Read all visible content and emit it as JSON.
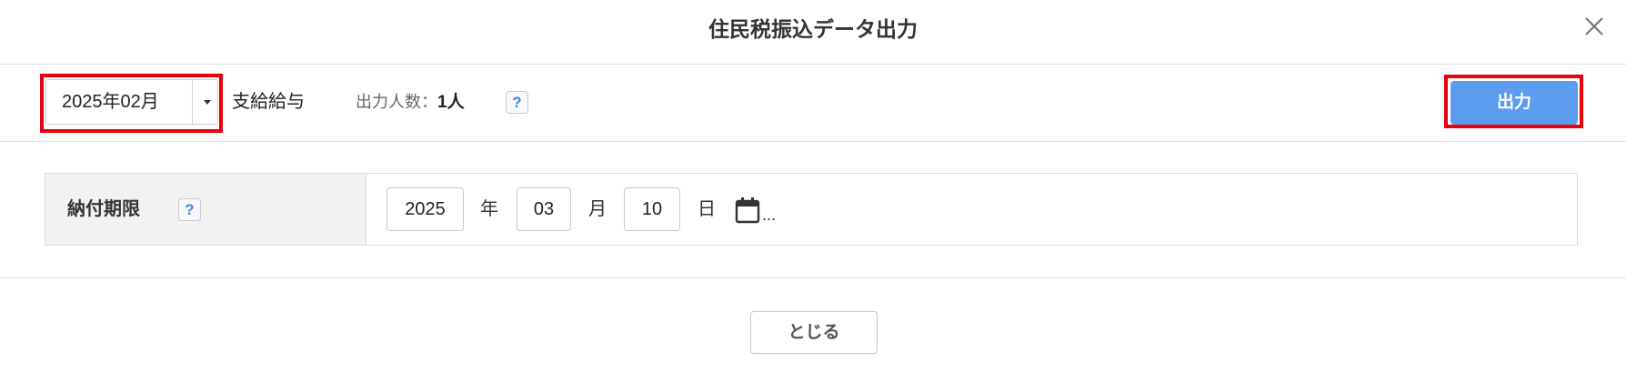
{
  "dialog": {
    "title": "住民税振込データ出力",
    "close_icon": "close-icon"
  },
  "toolbar": {
    "period_select": {
      "value": "2025年02月",
      "caret_icon": "chevron-down-icon"
    },
    "payment_type": "支給給与",
    "count_label": "出力人数：",
    "count_value": "1人",
    "help_label": "?",
    "output_button": "出力"
  },
  "form": {
    "deadline": {
      "label": "納付期限",
      "help_label": "?",
      "year": "2025",
      "year_unit": "年",
      "month": "03",
      "month_unit": "月",
      "day": "10",
      "day_unit": "日",
      "calendar_icon": "calendar-icon",
      "more": "..."
    }
  },
  "footer": {
    "close_button": "とじる"
  },
  "colors": {
    "primary_button": "#5b9cee",
    "highlight_annotation": "#e8000b",
    "label_background": "#f2f2f2",
    "help_icon": "#3d86e0"
  }
}
